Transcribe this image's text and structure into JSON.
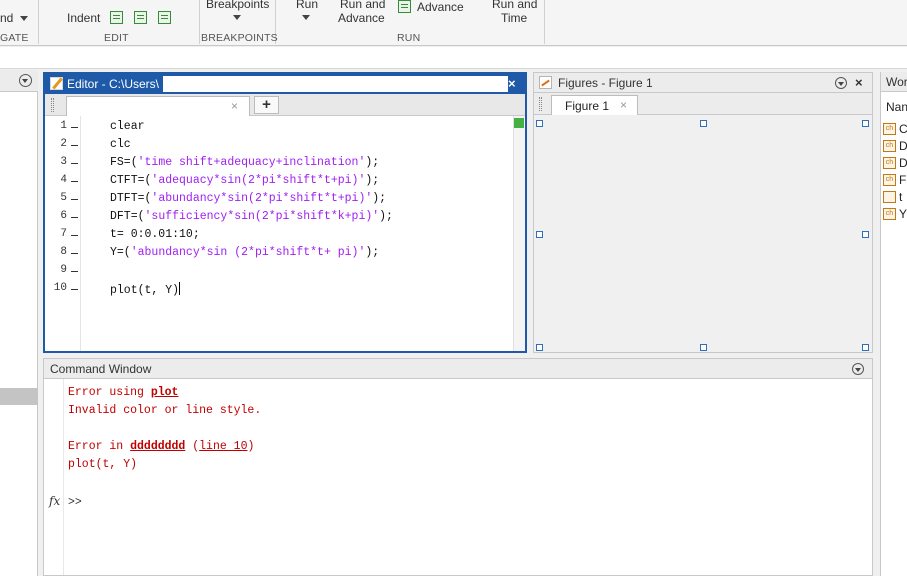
{
  "toolstrip": {
    "nav_partial": "nd",
    "indent_label": "Indent",
    "breakpoints_label": "Breakpoints",
    "run_label": "Run",
    "run_advance_line1": "Run and",
    "run_advance_line2": "Advance",
    "advance_label": "Advance",
    "run_time_line1": "Run and",
    "run_time_line2": "Time",
    "sections": {
      "navigate_partial": "GATE",
      "edit": "EDIT",
      "breakpoints": "BREAKPOINTS",
      "run": "RUN"
    }
  },
  "editor": {
    "title_prefix": "Editor - C:\\Users\\",
    "close": "×",
    "tab_close": "×",
    "add_tab": "+",
    "lines": [
      {
        "n": "1",
        "segments": [
          {
            "t": "clear",
            "s": false
          }
        ]
      },
      {
        "n": "2",
        "segments": [
          {
            "t": "clc",
            "s": false
          }
        ]
      },
      {
        "n": "3",
        "segments": [
          {
            "t": "FS=(",
            "s": false
          },
          {
            "t": "'time shift+adequacy+inclination'",
            "s": true
          },
          {
            "t": ");",
            "s": false
          }
        ]
      },
      {
        "n": "4",
        "segments": [
          {
            "t": "CTFT=(",
            "s": false
          },
          {
            "t": "'adequacy*sin(2*pi*shift*t+pi)'",
            "s": true
          },
          {
            "t": ");",
            "s": false
          }
        ]
      },
      {
        "n": "5",
        "segments": [
          {
            "t": "DTFT=(",
            "s": false
          },
          {
            "t": "'abundancy*sin(2*pi*shift*t+pi)'",
            "s": true
          },
          {
            "t": ");",
            "s": false
          }
        ]
      },
      {
        "n": "6",
        "segments": [
          {
            "t": "DFT=(",
            "s": false
          },
          {
            "t": "'sufficiency*sin(2*pi*shift*k+pi)'",
            "s": true
          },
          {
            "t": ");",
            "s": false
          }
        ]
      },
      {
        "n": "7",
        "segments": [
          {
            "t": "t= 0:0.01:10;",
            "s": false
          }
        ]
      },
      {
        "n": "8",
        "segments": [
          {
            "t": "Y=(",
            "s": false
          },
          {
            "t": "'abundancy*sin (2*pi*shift*t+ pi)'",
            "s": true
          },
          {
            "t": ");",
            "s": false
          }
        ]
      },
      {
        "n": "9",
        "segments": []
      },
      {
        "n": "10",
        "segments": [
          {
            "t": "plot(t, Y)",
            "s": false
          }
        ]
      }
    ]
  },
  "figures": {
    "title": "Figures - Figure 1",
    "tab_label": "Figure 1",
    "tab_close": "×",
    "close": "×"
  },
  "command_window": {
    "title": "Command Window",
    "line1_prefix": "Error using ",
    "line1_link": "plot",
    "line2": "Invalid color or line style.",
    "line3_prefix": "Error in ",
    "line3_link": "dddddddd",
    "line3_mid": " (",
    "line3_link2": "line 10",
    "line3_suffix": ")",
    "line4": "plot(t, Y)",
    "fx": "fx",
    "prompt": ">>"
  },
  "workspace": {
    "title_partial": "Wor",
    "header_partial": "Nan",
    "variables": [
      {
        "icon": "ch",
        "name": "C"
      },
      {
        "icon": "ch",
        "name": "D"
      },
      {
        "icon": "ch",
        "name": "D"
      },
      {
        "icon": "ch",
        "name": "FS"
      },
      {
        "icon": "",
        "name": "t"
      },
      {
        "icon": "ch",
        "name": "Y"
      }
    ]
  },
  "colors": {
    "active_title": "#1e5aa8",
    "string": "#a020f0",
    "error": "#c00000"
  }
}
